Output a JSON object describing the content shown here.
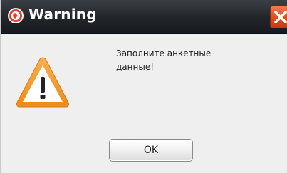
{
  "window": {
    "title": "Warning",
    "close_icon": "close-icon",
    "app_icon": "app-logo-icon"
  },
  "dialog": {
    "icon": "warning-icon",
    "message": "Заполните анкетные\nданные!",
    "ok_label": "OK"
  },
  "colors": {
    "titlebar": "#23272c",
    "close_button": "#df4a1f",
    "dialog_background": "#efefef",
    "warning_triangle": "#f3a233"
  }
}
